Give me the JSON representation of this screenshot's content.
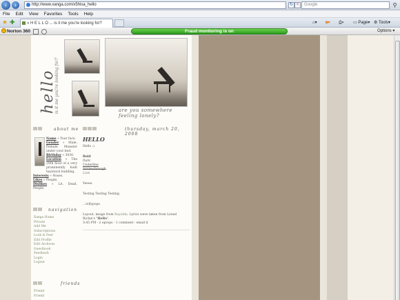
{
  "browser": {
    "url": "http://www.xanga.com/x5hisa_hello",
    "search_placeholder": "Google",
    "menu": [
      "File",
      "Edit",
      "View",
      "Favorites",
      "Tools",
      "Help"
    ],
    "tab_title": "» H E L L O ... is it me you're looking for?",
    "commands": {
      "page": "Page",
      "tools": "Tools"
    }
  },
  "norton": {
    "brand": "Norton 360",
    "fraud_status": "Fraud monitoring is on",
    "options": "Options"
  },
  "blog": {
    "header_word": "hello",
    "header_sub": "is it me you're looking for?",
    "caption": "are you somewhere feeling lonely?",
    "about_heading": "about me",
    "about_lines": [
      {
        "label": "Name",
        "text": " » Your face."
      },
      {
        "label": "Gender",
        "text": " » Male. Female. Monster under your bed."
      },
      {
        "label": "Birthday",
        "text": " » 3030."
      },
      {
        "label": "Location",
        "text": " » The 29th floor of a very prominently built haystack building."
      },
      {
        "label": "Interests",
        "text": " » Noses."
      },
      {
        "label": "Likes",
        "text": " » People."
      },
      {
        "label": "Dislikes",
        "text": " » LA. Dead. People."
      }
    ],
    "nav_heading": "navigation",
    "nav_links": [
      "Xanga Home",
      "Private",
      "Add Me",
      "Subscriptions",
      "Look & Feel",
      "Edit Profile",
      "Edit Archives",
      "Guestbook",
      "Feedback",
      "Login",
      "Logout"
    ],
    "friends_heading": "friends",
    "friends_links": [
      "Friend",
      "Friend"
    ],
    "date": "thursday, march 20, 2008",
    "post": {
      "title": "HELLO",
      "greeting": "Hello :)",
      "bold": "Bold",
      "italic": "Italic",
      "underline": "Underline",
      "strike": "Strike-through",
      "link": "Link",
      "text1": "Yeeee.",
      "text2": "Testing Testing Testing.",
      "text3": "...lollypops.",
      "credit_prefix": "Layout, image from ",
      "credit_source": "Rayoldu",
      "credit_mid": ". Lyrics were taken from Lionel Richie's \"",
      "credit_song": "Hello",
      "credit_end": "\".",
      "footer": "3:45 PM - 2 eprops - 1 comment - email it"
    }
  },
  "colors": {
    "page_bg": "#d9d4ca",
    "brown_column": "#a59580",
    "link": "#7a8d6a",
    "fraud_green": "#2c9a1b"
  }
}
